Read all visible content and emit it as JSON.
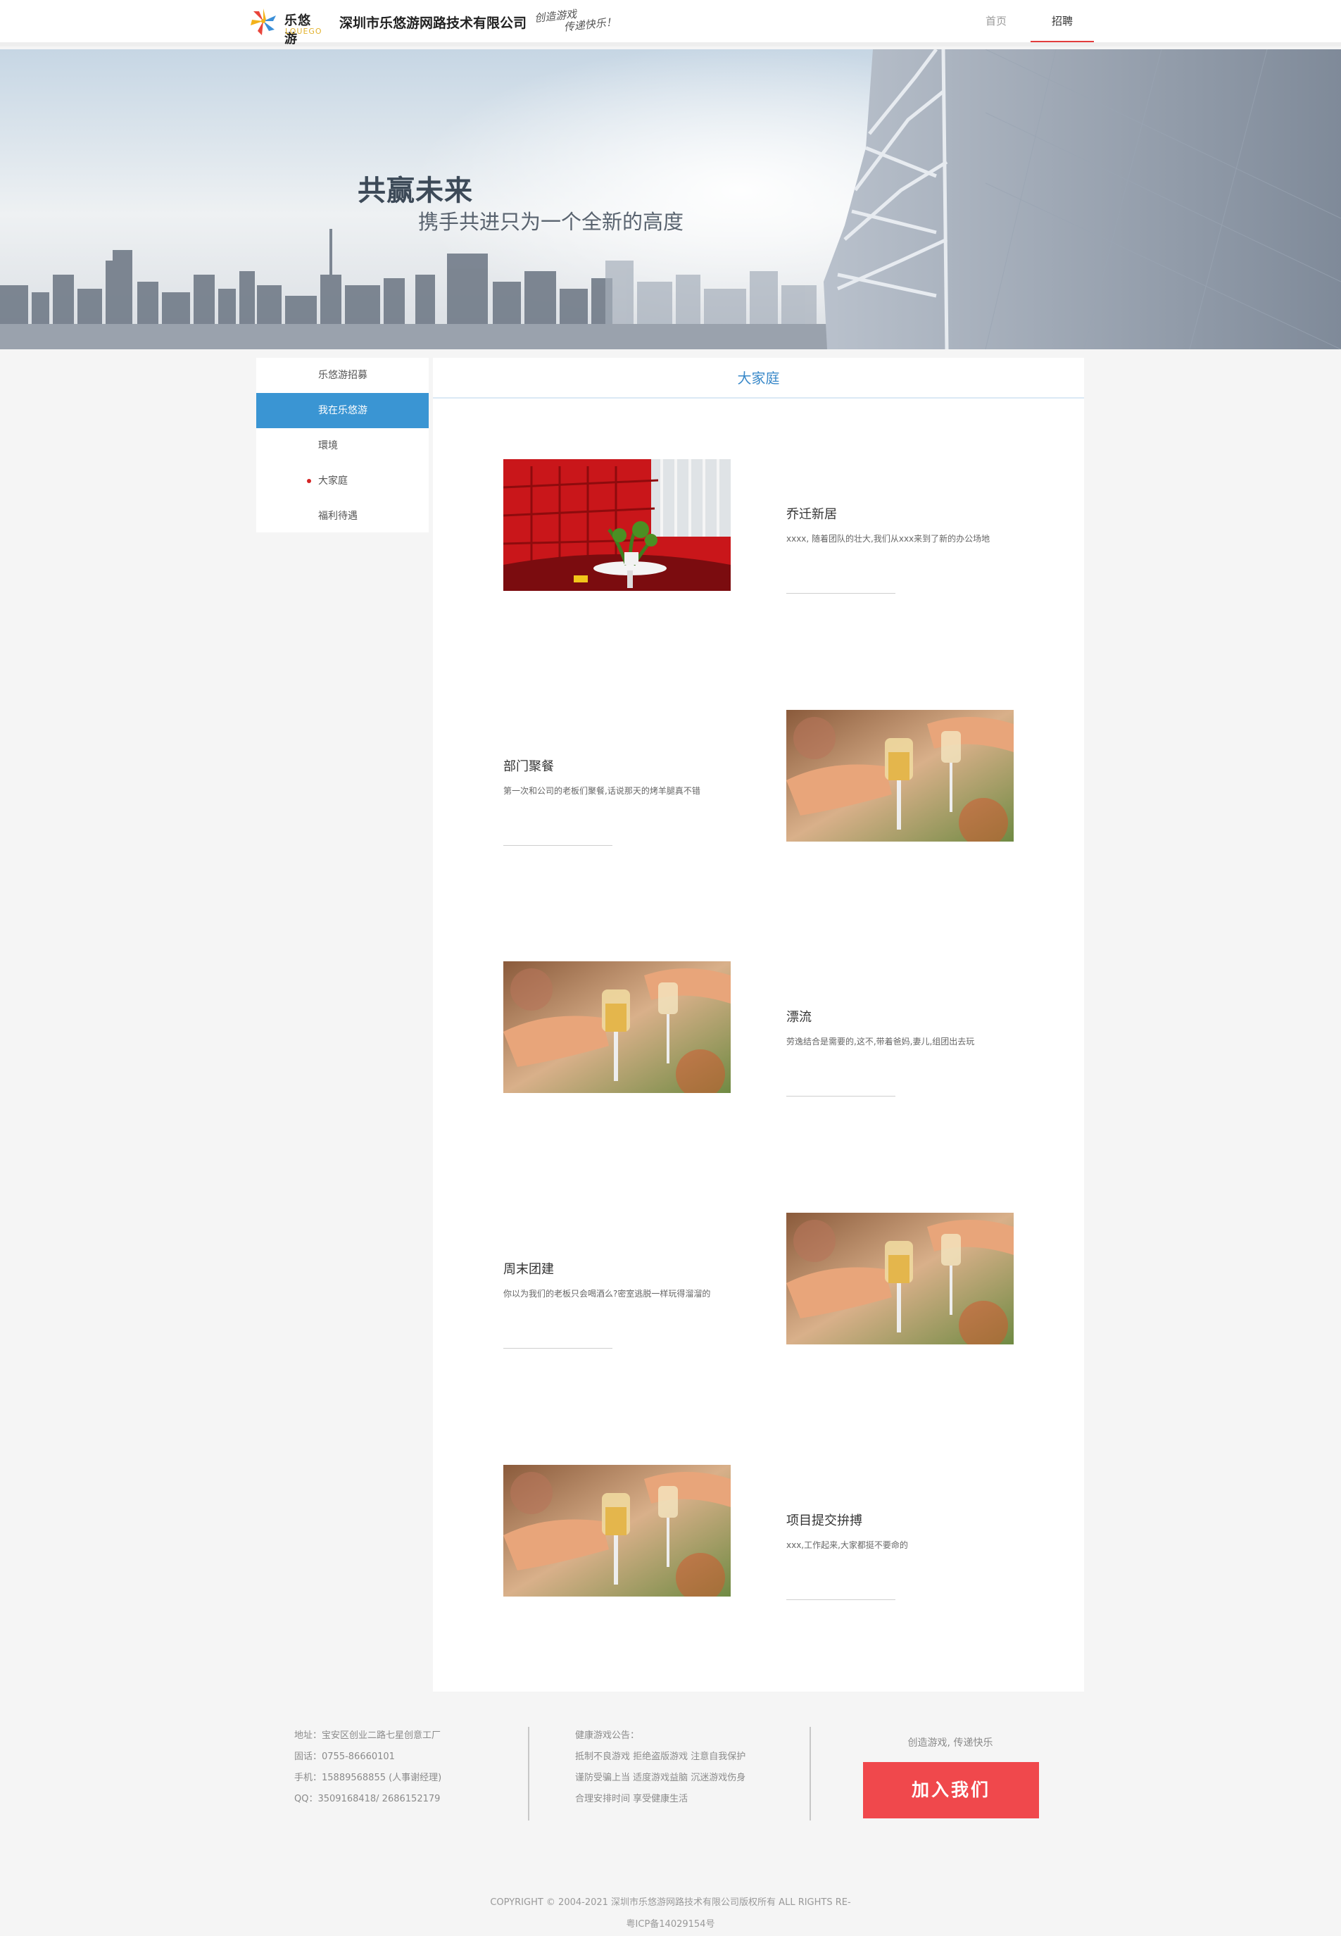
{
  "header": {
    "brand_cn": "乐悠游",
    "brand_en": "LOUEGO",
    "company": "深圳市乐悠游网路技术有限公司",
    "slogan_line1": "创造游戏",
    "slogan_line2": "传递快乐！",
    "nav": [
      {
        "label": "首页"
      },
      {
        "label": "招聘"
      }
    ]
  },
  "banner": {
    "heading": "共赢未来",
    "subheading": "携手共进只为一个全新的高度"
  },
  "sidebar": {
    "items": [
      {
        "label": "乐悠游招募"
      },
      {
        "label": "我在乐悠游"
      },
      {
        "label": "環境"
      },
      {
        "label": "大家庭"
      },
      {
        "label": "福利待遇"
      }
    ]
  },
  "main": {
    "title": "大家庭",
    "entries": [
      {
        "title": "乔迁新居",
        "desc": "xxxx, 随着团队的壮大,我们从xxx来到了新的办公场地",
        "image": "office-photo"
      },
      {
        "title": "部门聚餐",
        "desc": "第一次和公司的老板们聚餐,话说那天的烤羊腿真不错",
        "image": "toast-photo"
      },
      {
        "title": "漂流",
        "desc": "劳逸结合是需要的,这不,带着爸妈,妻儿,组团出去玩",
        "image": "toast-photo"
      },
      {
        "title": "周末团建",
        "desc": "你以为我们的老板只会喝酒么?密室逃脱一样玩得溜溜的",
        "image": "toast-photo"
      },
      {
        "title": "项目提交拚搏",
        "desc": "xxx,工作起来,大家都挺不要命的",
        "image": "toast-photo"
      }
    ]
  },
  "footer": {
    "address": "地址：宝安区创业二路七星创意工厂",
    "phone": "固话：0755-86660101",
    "mobile": "手机：15889568855 (人事谢经理)",
    "qq": "QQ：3509168418/ 2686152179",
    "health_title": "健康游戏公告：",
    "health_line1": "抵制不良游戏 拒绝盗版游戏 注意自我保护",
    "health_line2": "谨防受骗上当 适度游戏益脑 沉迷游戏伤身",
    "health_line3": "合理安排时间 享受健康生活",
    "tagline": "创造游戏, 传递快乐",
    "join_label": "加入我们",
    "copyright": "COPYRIGHT © 2004-2021 深圳市乐悠游网路技术有限公司版权所有 ALL RIGHTS RE-",
    "icp": "粤ICP备14029154号"
  },
  "colors": {
    "accent_blue": "#3a95d3",
    "title_blue": "#3a89c9",
    "nav_active_underline": "#e23d3d",
    "join_button": "#f0484c",
    "page_bg": "#f5f5f5"
  }
}
